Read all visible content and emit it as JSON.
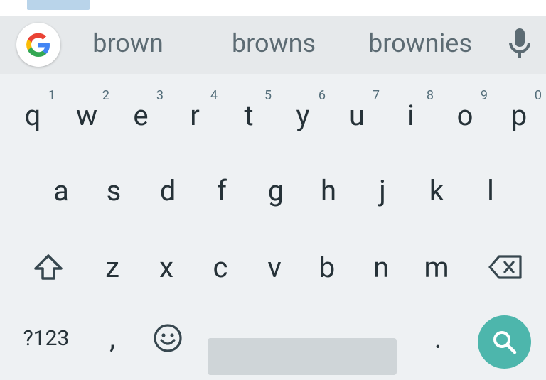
{
  "suggestions": [
    "brown",
    "browns",
    "brownies"
  ],
  "row1": [
    {
      "key": "q",
      "hint": "1"
    },
    {
      "key": "w",
      "hint": "2"
    },
    {
      "key": "e",
      "hint": "3"
    },
    {
      "key": "r",
      "hint": "4"
    },
    {
      "key": "t",
      "hint": "5"
    },
    {
      "key": "y",
      "hint": "6"
    },
    {
      "key": "u",
      "hint": "7"
    },
    {
      "key": "i",
      "hint": "8"
    },
    {
      "key": "o",
      "hint": "9"
    },
    {
      "key": "p",
      "hint": "0"
    }
  ],
  "row2": [
    "a",
    "s",
    "d",
    "f",
    "g",
    "h",
    "j",
    "k",
    "l"
  ],
  "row3": [
    "z",
    "x",
    "c",
    "v",
    "b",
    "n",
    "m"
  ],
  "row4": {
    "symbols_label": "?123",
    "comma": ",",
    "period": "."
  },
  "icons": {
    "google": "google-icon",
    "mic": "microphone-icon",
    "shift": "shift-icon",
    "backspace": "backspace-icon",
    "emoji": "emoji-icon",
    "search": "search-icon"
  },
  "colors": {
    "accent": "#4db6ac",
    "keyboard_bg": "#eef1f3",
    "suggestion_bg": "#e6e9eb"
  }
}
